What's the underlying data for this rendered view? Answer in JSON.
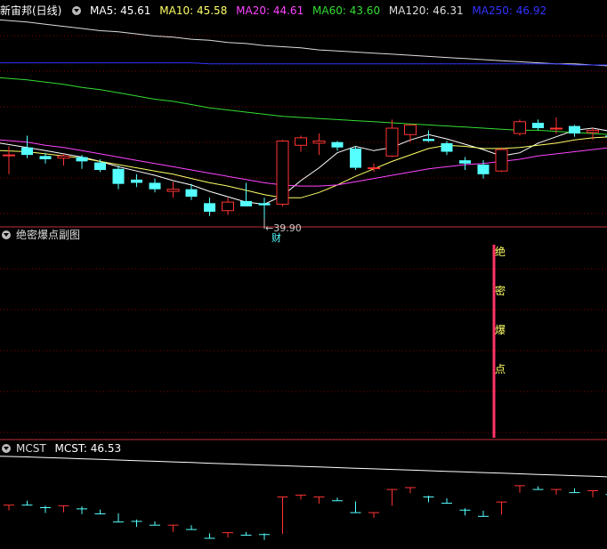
{
  "main": {
    "title": "新宙邦(日线)",
    "ma": [
      {
        "label": "MA5: 45.61",
        "color": "#ffffff",
        "key": "ma5"
      },
      {
        "label": "MA10: 45.58",
        "color": "#ffff66",
        "key": "ma10"
      },
      {
        "label": "MA20: 44.61",
        "color": "#ff44ff",
        "key": "ma20"
      },
      {
        "label": "MA60: 43.60",
        "color": "#33dd33",
        "key": "ma60"
      },
      {
        "label": "MA120: 46.31",
        "color": "#dddddd",
        "key": "ma120"
      },
      {
        "label": "MA250: 46.92",
        "color": "#3333ff",
        "key": "ma250"
      }
    ],
    "low_marker": "39.90",
    "event_badge": "财"
  },
  "sub": {
    "title": "绝密爆点副图",
    "signal_chars": [
      "绝",
      "密",
      "爆",
      "点"
    ]
  },
  "mcst": {
    "title": "MCST",
    "value_label": "MCST: 46.53"
  },
  "colors": {
    "up": "#ff3333",
    "down": "#55ffff",
    "grid": "#800000",
    "signal": "#ff3366"
  },
  "chart_data": {
    "type": "candlestick",
    "candles": [
      {
        "o": 45.8,
        "h": 46.6,
        "l": 44.0,
        "c": 45.8
      },
      {
        "o": 46.5,
        "h": 47.6,
        "l": 45.5,
        "c": 45.8
      },
      {
        "o": 45.7,
        "h": 46.0,
        "l": 45.0,
        "c": 45.4
      },
      {
        "o": 45.5,
        "h": 45.9,
        "l": 44.8,
        "c": 45.7
      },
      {
        "o": 45.6,
        "h": 45.8,
        "l": 44.5,
        "c": 45.2
      },
      {
        "o": 45.1,
        "h": 45.4,
        "l": 44.2,
        "c": 44.4
      },
      {
        "o": 44.5,
        "h": 44.8,
        "l": 42.6,
        "c": 43.1
      },
      {
        "o": 43.5,
        "h": 44.0,
        "l": 42.8,
        "c": 43.2
      },
      {
        "o": 43.2,
        "h": 43.6,
        "l": 42.3,
        "c": 42.6
      },
      {
        "o": 42.4,
        "h": 43.3,
        "l": 41.8,
        "c": 42.6
      },
      {
        "o": 42.6,
        "h": 43.1,
        "l": 41.6,
        "c": 41.9
      },
      {
        "o": 41.3,
        "h": 41.8,
        "l": 40.1,
        "c": 40.5
      },
      {
        "o": 40.6,
        "h": 41.8,
        "l": 40.2,
        "c": 41.4
      },
      {
        "o": 41.5,
        "h": 43.2,
        "l": 41.0,
        "c": 41.0
      },
      {
        "o": 41.3,
        "h": 41.8,
        "l": 39.9,
        "c": 41.1
      },
      {
        "o": 41.2,
        "h": 47.2,
        "l": 41.0,
        "c": 47.1
      },
      {
        "o": 46.7,
        "h": 47.6,
        "l": 46.1,
        "c": 47.4
      },
      {
        "o": 46.9,
        "h": 47.8,
        "l": 45.8,
        "c": 47.1
      },
      {
        "o": 47.0,
        "h": 47.1,
        "l": 46.2,
        "c": 46.5
      },
      {
        "o": 46.4,
        "h": 46.6,
        "l": 44.4,
        "c": 44.6
      },
      {
        "o": 44.6,
        "h": 45.0,
        "l": 44.2,
        "c": 44.6
      },
      {
        "o": 45.7,
        "h": 49.1,
        "l": 45.6,
        "c": 48.3
      },
      {
        "o": 47.7,
        "h": 48.6,
        "l": 47.0,
        "c": 48.6
      },
      {
        "o": 47.3,
        "h": 48.1,
        "l": 47.0,
        "c": 47.1
      },
      {
        "o": 46.9,
        "h": 47.1,
        "l": 45.8,
        "c": 46.1
      },
      {
        "o": 45.3,
        "h": 45.6,
        "l": 44.4,
        "c": 45.0
      },
      {
        "o": 44.9,
        "h": 45.3,
        "l": 43.6,
        "c": 44.0
      },
      {
        "o": 44.3,
        "h": 46.5,
        "l": 44.2,
        "c": 46.3
      },
      {
        "o": 47.8,
        "h": 49.1,
        "l": 47.6,
        "c": 48.9
      },
      {
        "o": 48.8,
        "h": 49.1,
        "l": 48.1,
        "c": 48.3
      },
      {
        "o": 48.3,
        "h": 49.3,
        "l": 47.8,
        "c": 48.3
      },
      {
        "o": 48.5,
        "h": 48.6,
        "l": 47.5,
        "c": 47.8
      },
      {
        "o": 47.9,
        "h": 48.3,
        "l": 47.2,
        "c": 48.1
      },
      {
        "o": 47.6,
        "h": 47.7,
        "l": 47.3,
        "c": 47.5
      },
      {
        "o": 47.2,
        "h": 47.5,
        "l": 46.6,
        "c": 46.8
      }
    ],
    "ma": {
      "ma5": [
        46.9,
        46.5,
        46.2,
        45.9,
        45.6,
        45.2,
        44.7,
        44.3,
        43.9,
        43.4,
        43.0,
        42.4,
        41.9,
        41.4,
        41.2,
        42.0,
        43.4,
        44.6,
        46.0,
        46.6,
        46.2,
        46.5,
        47.2,
        47.7,
        47.3,
        46.8,
        46.3,
        45.7,
        46.0,
        46.9,
        47.5,
        48.1,
        48.3,
        48.0,
        47.7
      ],
      "ma10": [
        46.2,
        46.1,
        45.9,
        45.7,
        45.5,
        45.2,
        44.9,
        44.6,
        44.3,
        44.0,
        43.6,
        43.2,
        42.9,
        42.5,
        42.1,
        41.8,
        41.8,
        42.3,
        43.0,
        43.8,
        44.5,
        45.2,
        45.8,
        46.4,
        46.7,
        46.6,
        46.4,
        46.4,
        46.5,
        46.7,
        46.9,
        47.2,
        47.4,
        47.5,
        47.6
      ],
      "ma20": [
        47.2,
        47.0,
        46.7,
        46.5,
        46.2,
        45.9,
        45.6,
        45.3,
        45.0,
        44.7,
        44.4,
        44.1,
        43.8,
        43.5,
        43.2,
        43.0,
        42.9,
        42.9,
        43.0,
        43.3,
        43.6,
        43.9,
        44.2,
        44.5,
        44.7,
        44.9,
        45.0,
        45.2,
        45.4,
        45.7,
        45.9,
        46.1,
        46.3,
        46.5,
        46.7
      ],
      "ma60": [
        53.0,
        52.8,
        52.6,
        52.4,
        52.1,
        51.9,
        51.6,
        51.3,
        51.0,
        50.8,
        50.5,
        50.2,
        50.0,
        49.8,
        49.6,
        49.4,
        49.3,
        49.2,
        49.1,
        49.0,
        48.9,
        48.8,
        48.7,
        48.6,
        48.5,
        48.4,
        48.3,
        48.2,
        48.1,
        48.1,
        48.0,
        47.9,
        47.8,
        47.7,
        47.6
      ],
      "ma120": [
        58.4,
        58.2,
        58.0,
        57.8,
        57.6,
        57.4,
        57.3,
        57.1,
        56.9,
        56.8,
        56.6,
        56.5,
        56.3,
        56.2,
        56.0,
        55.9,
        55.8,
        55.6,
        55.5,
        55.4,
        55.3,
        55.2,
        55.1,
        55.0,
        54.9,
        54.8,
        54.7,
        54.6,
        54.5,
        54.4,
        54.3,
        54.3,
        54.2,
        54.1,
        54.0
      ],
      "ma250": [
        54.4,
        54.4,
        54.4,
        54.4,
        54.4,
        54.4,
        54.4,
        54.4,
        54.4,
        54.4,
        54.4,
        54.3,
        54.3,
        54.3,
        54.3,
        54.3,
        54.3,
        54.3,
        54.3,
        54.3,
        54.3,
        54.3,
        54.3,
        54.3,
        54.3,
        54.3,
        54.3,
        54.3,
        54.3,
        54.3,
        54.3,
        54.2,
        54.2,
        54.2,
        54.2
      ]
    },
    "mcst_series": [
      53.6,
      53.5,
      53.4,
      53.3,
      53.2,
      53.1,
      53.0,
      52.9,
      52.8,
      52.7,
      52.6,
      52.5,
      52.4,
      52.3,
      52.2,
      52.1,
      52.0,
      51.9,
      51.8,
      51.7,
      51.6,
      51.5,
      51.4,
      51.3,
      51.2,
      51.1,
      51.0,
      50.9,
      50.8,
      50.7,
      50.6,
      50.5,
      50.4,
      50.3,
      50.2
    ],
    "signal_bar_index": 26
  }
}
